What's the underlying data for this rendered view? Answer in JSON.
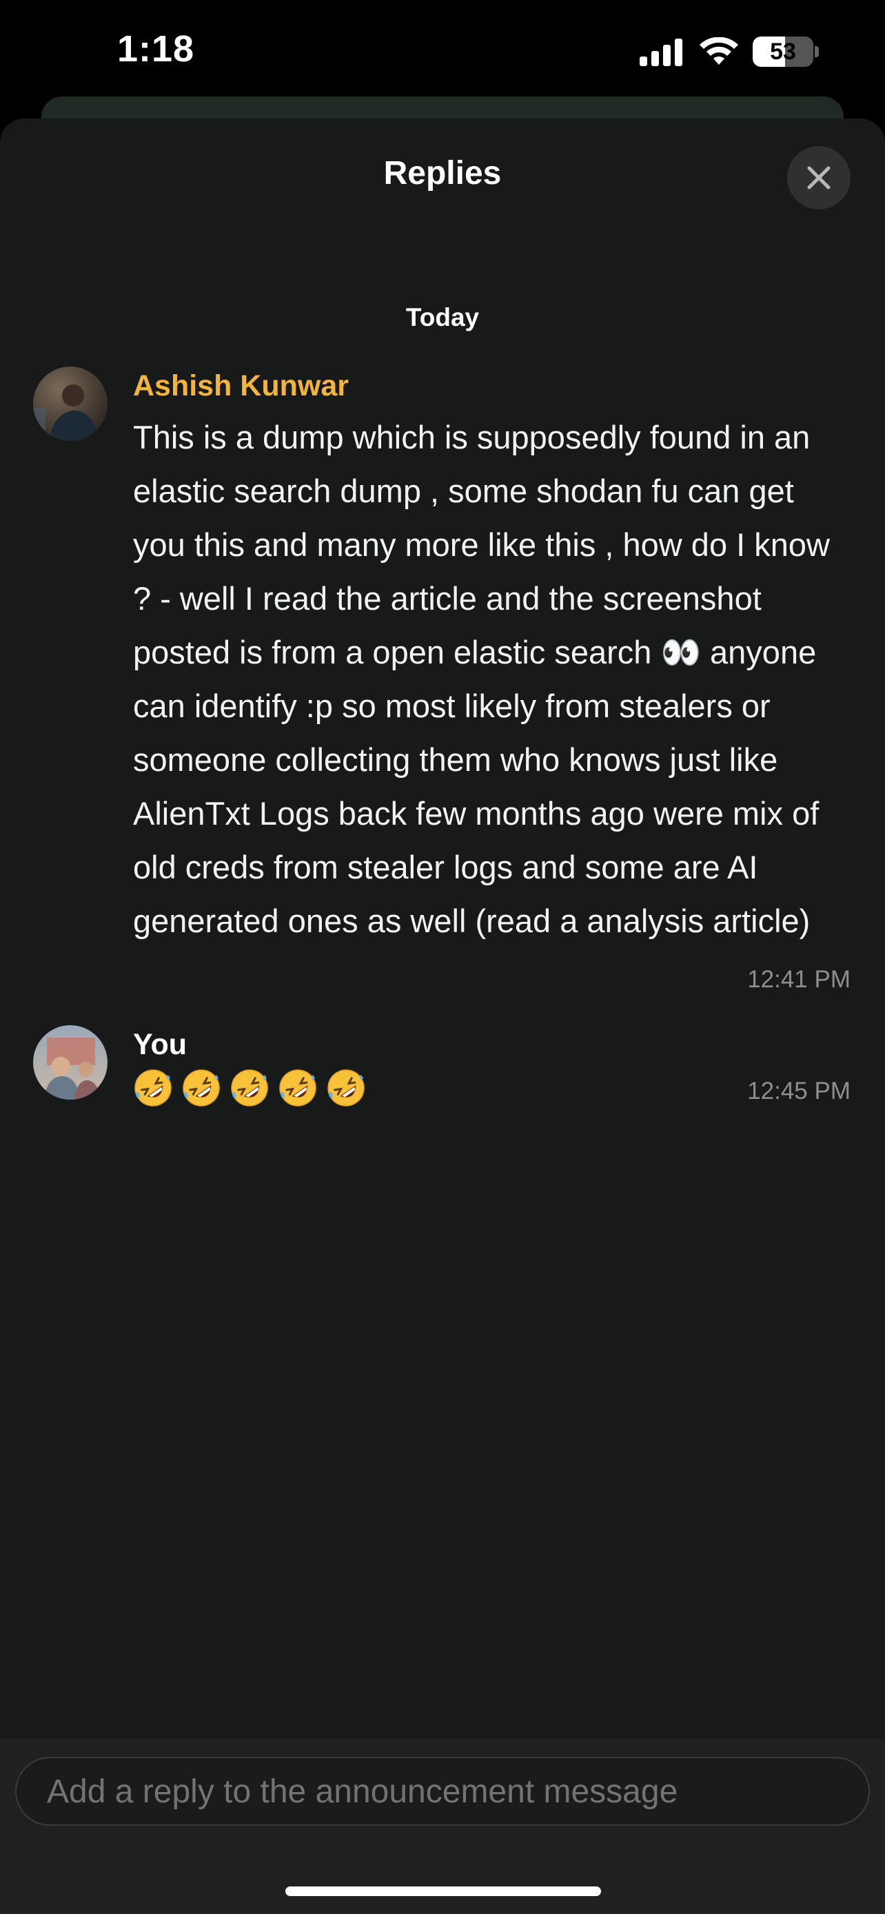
{
  "status_bar": {
    "time": "1:18",
    "battery_level": "53",
    "battery_fraction": 0.53
  },
  "sheet": {
    "title": "Replies",
    "date_separator": "Today"
  },
  "messages": [
    {
      "sender": "Ashish Kunwar",
      "sender_color": "#f2b43c",
      "text": "This is a dump which is supposedly found in an elastic search dump , some shodan fu can get you this and many more like this , how do I know ? - well I read the article and the screenshot posted is from a open elastic search 👀 anyone can identify :p so most likely from stealers or someone collecting them who knows just like AlienTxt Logs back few months ago were mix of old creds from stealer logs and some are AI generated ones as well (read a analysis article)",
      "time": "12:41 PM"
    },
    {
      "sender": "You",
      "sender_color": "#ffffff",
      "emoji_icons": [
        "rofl-emoji",
        "rofl-emoji",
        "rofl-emoji",
        "rofl-emoji",
        "rofl-emoji"
      ],
      "time": "12:45 PM"
    }
  ],
  "composer": {
    "placeholder": "Add a reply to the announcement message"
  },
  "icons": {
    "close": "close-icon",
    "signal": "signal-icon",
    "wifi": "wifi-icon",
    "battery": "battery-icon"
  },
  "colors": {
    "sheet_background": "#181919",
    "accent_sender": "#f2b43c",
    "timestamp": "#8e9090"
  }
}
